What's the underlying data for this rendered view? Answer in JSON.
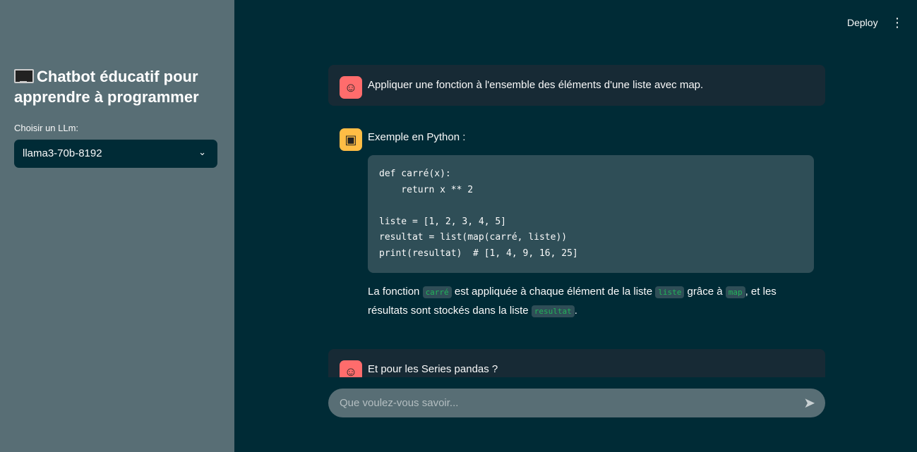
{
  "sidebar": {
    "title": "Chatbot éducatif pour apprendre à programmer",
    "title_icon": "desktop-computer-icon",
    "select_label": "Choisir un LLm:",
    "select_value": "llama3-70b-8192"
  },
  "header": {
    "deploy": "Deploy",
    "menu_icon": "vertical-dots-icon"
  },
  "colors": {
    "main_bg": "#002b36",
    "sidebar_bg": "#586e75",
    "user_avatar": "#ff6c6c",
    "bot_avatar": "#ffbd45",
    "inline_code": "#22b35a"
  },
  "messages": [
    {
      "role": "user",
      "text": "Appliquer une fonction à l'ensemble des éléments d'une liste avec map."
    },
    {
      "role": "assistant",
      "intro": "Exemple en Python :",
      "code": "def carré(x):\n    return x ** 2\n\nliste = [1, 2, 3, 4, 5]\nresultat = list(map(carré, liste))\nprint(resultat)  # [1, 4, 9, 16, 25]",
      "p1": "La fonction ",
      "c1": "carré",
      "p2": " est appliquée à chaque élément de la liste ",
      "c2": "liste",
      "p3": " grâce à ",
      "c3": "map",
      "p4": ", et les résultats sont stockés dans la liste ",
      "c4": "resultat",
      "p5": "."
    },
    {
      "role": "user",
      "text": "Et pour les Series pandas ?"
    }
  ],
  "input": {
    "placeholder": "Que voulez-vous savoir..."
  }
}
